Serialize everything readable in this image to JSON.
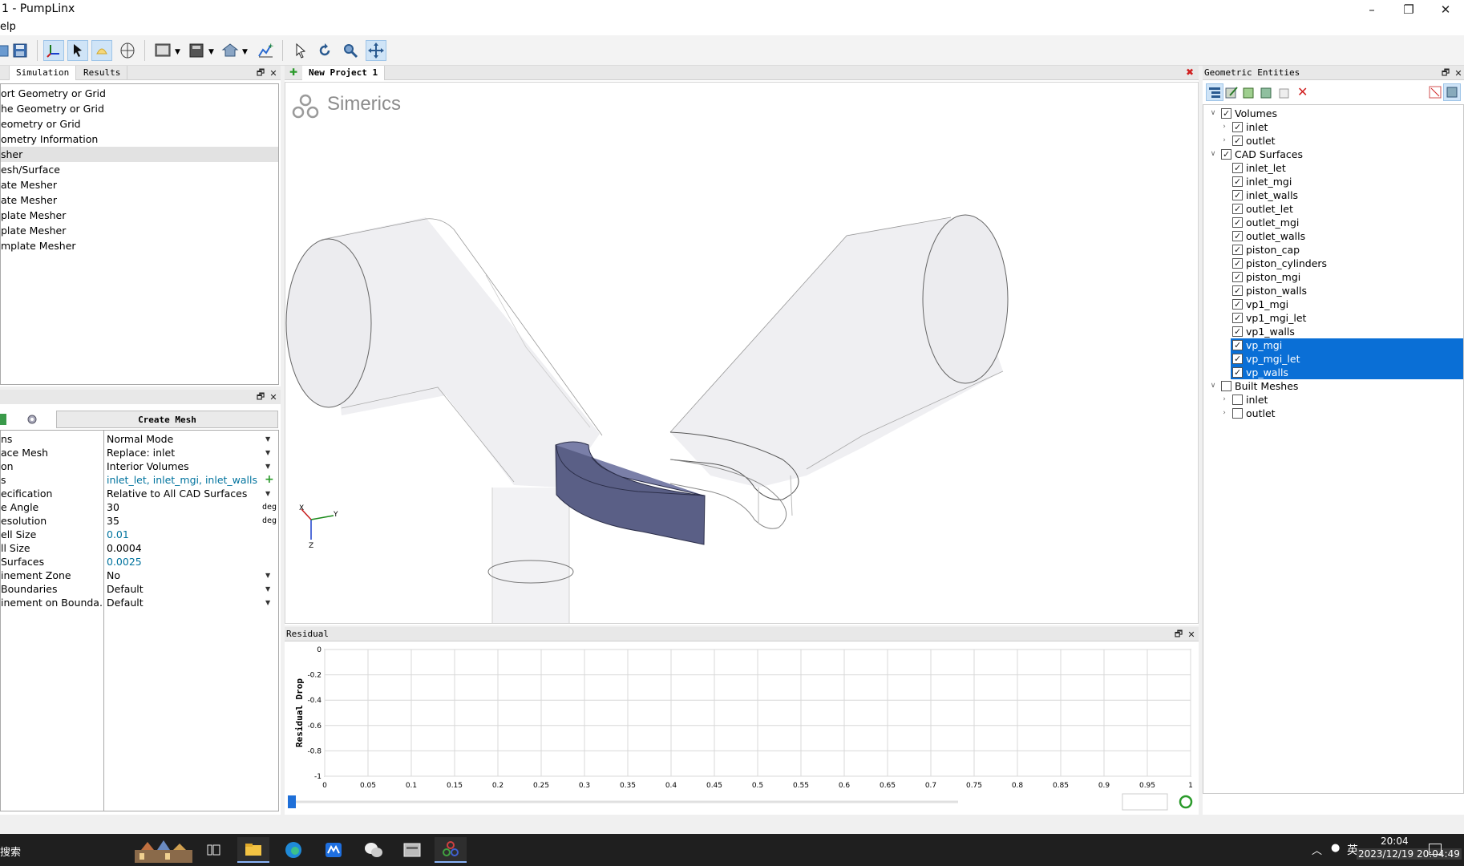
{
  "window": {
    "title": "1 - PumpLinx",
    "minimize": "–",
    "restore": "❐",
    "close": "✕"
  },
  "menu": {
    "label": "elp"
  },
  "left_tabs": {
    "simulation": "Simulation",
    "results": "Results"
  },
  "left_tree": [
    "ort Geometry or Grid",
    "he Geometry or Grid",
    "eometry or Grid",
    "ometry Information",
    "sher",
    "esh/Surface",
    "ate Mesher",
    "ate Mesher",
    "plate Mesher",
    "plate Mesher",
    "mplate Mesher"
  ],
  "left_tree_selected_index": 4,
  "mesher": {
    "create_label": "Create Mesh",
    "rows": [
      {
        "key": "ns",
        "value": "Normal Mode",
        "unit": "",
        "dropdown": true,
        "teal": false
      },
      {
        "key": "ace Mesh",
        "value": "Replace: inlet",
        "unit": "",
        "dropdown": true,
        "teal": false
      },
      {
        "key": "on",
        "value": "Interior Volumes",
        "unit": "",
        "dropdown": true,
        "teal": false
      },
      {
        "key": "s",
        "value": "inlet_let, inlet_mgi, inlet_walls",
        "unit": "",
        "dropdown": false,
        "teal": true,
        "plus": true
      },
      {
        "key": "ecification",
        "value": "Relative to All CAD Surfaces",
        "unit": "",
        "dropdown": true,
        "teal": false
      },
      {
        "key": "e Angle",
        "value": "30",
        "unit": "deg",
        "dropdown": false,
        "teal": false
      },
      {
        "key": "esolution",
        "value": "35",
        "unit": "deg",
        "dropdown": false,
        "teal": false
      },
      {
        "key": "ell Size",
        "value": "0.01",
        "unit": "",
        "dropdown": false,
        "teal": true
      },
      {
        "key": "ll Size",
        "value": "0.0004",
        "unit": "",
        "dropdown": false,
        "teal": false
      },
      {
        "key": "Surfaces",
        "value": "0.0025",
        "unit": "",
        "dropdown": false,
        "teal": true
      },
      {
        "key": "inement Zone",
        "value": "No",
        "unit": "",
        "dropdown": true,
        "teal": false
      },
      {
        "key": "Boundaries",
        "value": "Default",
        "unit": "",
        "dropdown": true,
        "teal": false
      },
      {
        "key": "inement on Bounda...",
        "value": "Default",
        "unit": "",
        "dropdown": true,
        "teal": false
      }
    ]
  },
  "project_tab": "New Project 1",
  "logo_text": "Simerics",
  "residual": {
    "title": "Residual",
    "ylabel": "Residual Drop"
  },
  "chart_data": {
    "type": "line",
    "title": "",
    "xlabel": "",
    "ylabel": "Residual Drop",
    "xlim": [
      0,
      1
    ],
    "ylim": [
      -1,
      0
    ],
    "x_ticks": [
      "0",
      "0.05",
      "0.1",
      "0.15",
      "0.2",
      "0.25",
      "0.3",
      "0.35",
      "0.4",
      "0.45",
      "0.5",
      "0.55",
      "0.6",
      "0.65",
      "0.7",
      "0.75",
      "0.8",
      "0.85",
      "0.9",
      "0.95",
      "1"
    ],
    "y_ticks": [
      "0",
      "-0.2",
      "-0.4",
      "-0.6",
      "-0.8",
      "-1"
    ],
    "grid": true,
    "series": []
  },
  "geo": {
    "title": "Geometric Entities",
    "tree": [
      {
        "label": "Volumes",
        "level": 0,
        "checked": true,
        "expanded": true,
        "selected": false
      },
      {
        "label": "inlet",
        "level": 1,
        "checked": true,
        "expandable": true,
        "selected": false
      },
      {
        "label": "outlet",
        "level": 1,
        "checked": true,
        "expandable": true,
        "selected": false
      },
      {
        "label": "CAD Surfaces",
        "level": 0,
        "checked": true,
        "expanded": true,
        "selected": false
      },
      {
        "label": "inlet_let",
        "level": 1,
        "checked": true,
        "selected": false
      },
      {
        "label": "inlet_mgi",
        "level": 1,
        "checked": true,
        "selected": false
      },
      {
        "label": "inlet_walls",
        "level": 1,
        "checked": true,
        "selected": false
      },
      {
        "label": "outlet_let",
        "level": 1,
        "checked": true,
        "selected": false
      },
      {
        "label": "outlet_mgi",
        "level": 1,
        "checked": true,
        "selected": false
      },
      {
        "label": "outlet_walls",
        "level": 1,
        "checked": true,
        "selected": false
      },
      {
        "label": "piston_cap",
        "level": 1,
        "checked": true,
        "selected": false
      },
      {
        "label": "piston_cylinders",
        "level": 1,
        "checked": true,
        "selected": false
      },
      {
        "label": "piston_mgi",
        "level": 1,
        "checked": true,
        "selected": false
      },
      {
        "label": "piston_walls",
        "level": 1,
        "checked": true,
        "selected": false
      },
      {
        "label": "vp1_mgi",
        "level": 1,
        "checked": true,
        "selected": false
      },
      {
        "label": "vp1_mgi_let",
        "level": 1,
        "checked": true,
        "selected": false
      },
      {
        "label": "vp1_walls",
        "level": 1,
        "checked": true,
        "selected": false
      },
      {
        "label": "vp_mgi",
        "level": 1,
        "checked": true,
        "selected": true
      },
      {
        "label": "vp_mgi_let",
        "level": 1,
        "checked": true,
        "selected": true
      },
      {
        "label": "vp_walls",
        "level": 1,
        "checked": true,
        "selected": true
      },
      {
        "label": "Built Meshes",
        "level": 0,
        "checked": false,
        "expanded": true,
        "selected": false
      },
      {
        "label": "inlet",
        "level": 1,
        "checked": false,
        "expandable": true,
        "selected": false
      },
      {
        "label": "outlet",
        "level": 1,
        "checked": false,
        "expandable": true,
        "selected": false
      }
    ]
  },
  "taskbar": {
    "search": "搜索",
    "ime": "英",
    "time": "20:04",
    "datetime": "2023/12/19 20:04:49"
  },
  "axes": {
    "x": "Y",
    "y": "X",
    "z": "Z"
  }
}
